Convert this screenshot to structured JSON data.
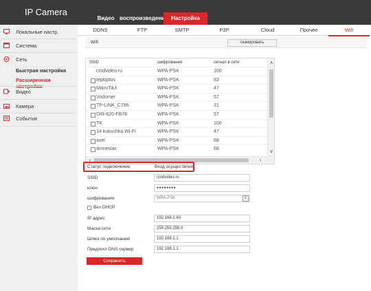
{
  "header": {
    "app_title": "IP Camera",
    "nav": [
      {
        "label": "Видео",
        "active": false
      },
      {
        "label": "воспроизведение",
        "active": false
      },
      {
        "label": "Настройка",
        "active": true
      }
    ]
  },
  "sidebar": {
    "items": [
      {
        "label": "Локальные настр.",
        "icon": "monitor-icon"
      },
      {
        "label": "Система",
        "icon": "system-icon"
      },
      {
        "label": "Сеть",
        "icon": "network-icon"
      },
      {
        "label": "Видео",
        "icon": "video-icon"
      },
      {
        "label": "Камера",
        "icon": "camera-icon"
      },
      {
        "label": "События",
        "icon": "events-icon"
      }
    ],
    "subitems": [
      {
        "label": "Быстрая настройка",
        "active": false
      },
      {
        "label": "Расширенная настройка",
        "active": true
      }
    ]
  },
  "tabs": [
    {
      "label": "DDNS",
      "active": false
    },
    {
      "label": "FTP",
      "active": false
    },
    {
      "label": "SMTP",
      "active": false
    },
    {
      "label": "P2P",
      "active": false
    },
    {
      "label": "Cloud",
      "active": false
    },
    {
      "label": "Прочее",
      "active": false
    },
    {
      "label": "Wifi",
      "active": true
    }
  ],
  "wifi": {
    "label": "Wifi",
    "scan_button": "сканировать",
    "table": {
      "headers": [
        "SSID",
        "шифрования",
        "сигнал в сети"
      ],
      "rows": [
        {
          "ssid": "cmdvideo.ru",
          "enc": "WPA-PSK",
          "signal": "100",
          "checkbox": false
        },
        {
          "ssid": "teploplus",
          "enc": "WPA-PSK",
          "signal": "83",
          "checkbox": true
        },
        {
          "ssid": "MikroTik3",
          "enc": "WPA-PSK",
          "signal": "47",
          "checkbox": true
        },
        {
          "ssid": "Vodomer",
          "enc": "WPA-PSK",
          "signal": "57",
          "checkbox": true
        },
        {
          "ssid": "TP-LINK_C796",
          "enc": "WPA-PSK",
          "signal": "31",
          "checkbox": true
        },
        {
          "ssid": "DIR-620-FB78",
          "enc": "WPA-PSK",
          "signal": "57",
          "checkbox": true
        },
        {
          "ssid": "TK",
          "enc": "WPA-PSK",
          "signal": "100",
          "checkbox": true
        },
        {
          "ssid": "14 kukushka Wi-Fi",
          "enc": "WPA-PSK",
          "signal": "47",
          "checkbox": true
        },
        {
          "ssid": "axel",
          "enc": "WPA-PSK",
          "signal": "68",
          "checkbox": true
        },
        {
          "ssid": "amneslac",
          "enc": "WPA-PSK",
          "signal": "68",
          "checkbox": true
        }
      ]
    }
  },
  "form": {
    "status_label": "Статус подключение",
    "status_value": "Вход осуществлен",
    "ssid_label": "SSID",
    "ssid_value": "cmdvideo.ru",
    "key_label": "ключ",
    "key_value": "●●●●●●●●",
    "encryption_label": "шифрования",
    "encryption_value": "WPA-PSK",
    "dhcp_label": "Вкл DHCP",
    "ip_label": "IP адрес",
    "ip_value": "192.168.1.40",
    "mask_label": "Маска сети",
    "mask_value": "255.255.255.0",
    "gateway_label": "Шлюз по умолчанию",
    "gateway_value": "192.168.1.1",
    "dns_label": "Предпочт DNS сервер",
    "dns_value": "192.168.1.1",
    "save_button": "Сохранить"
  },
  "colors": {
    "accent": "#d8282a",
    "topbar": "#3a3a3a",
    "sidebar": "#efefef"
  }
}
